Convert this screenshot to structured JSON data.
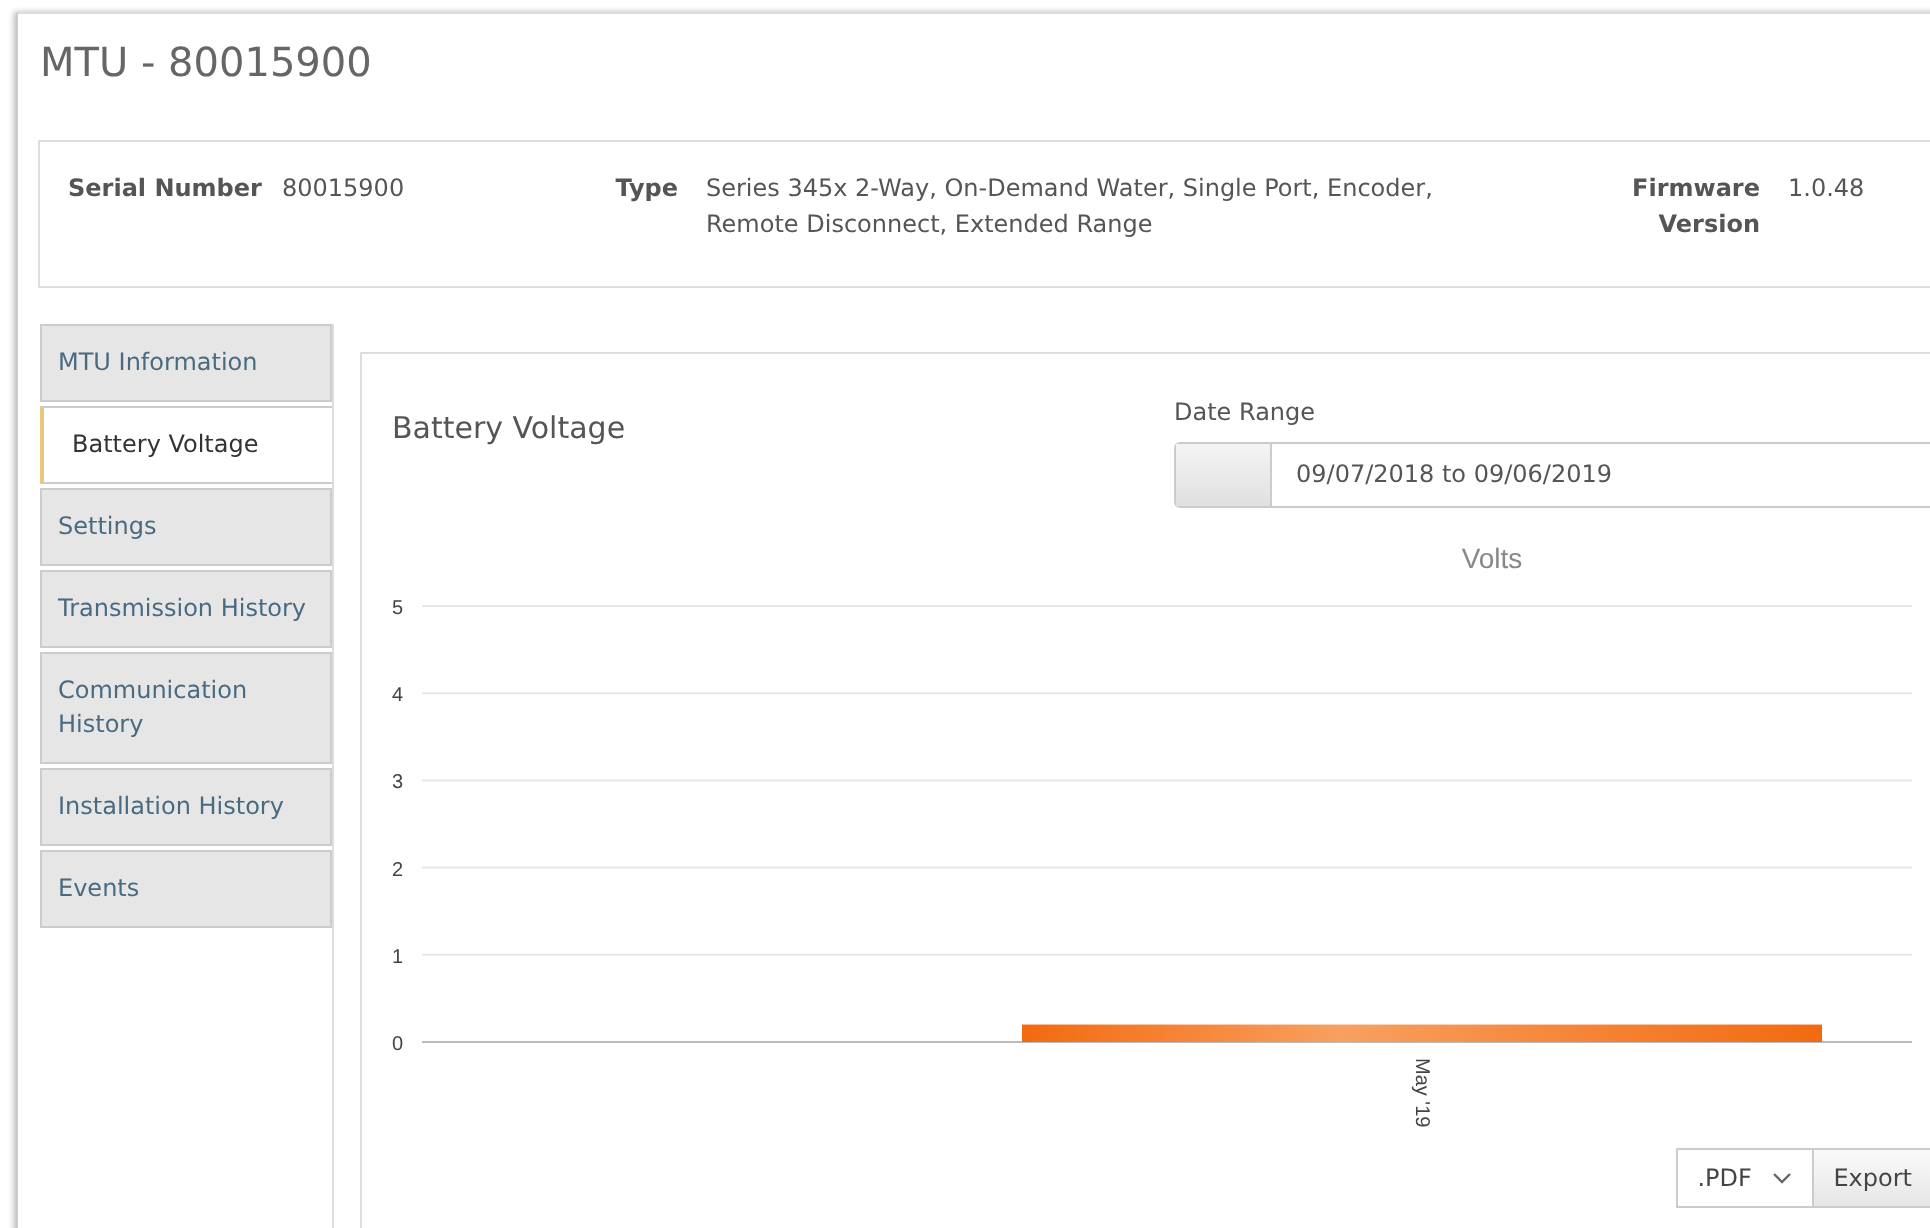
{
  "page_title": "MTU - 80015900",
  "info": [
    {
      "label": "Serial Number",
      "value": "80015900"
    },
    {
      "label": "Type",
      "value": "Series 345x 2-Way, On-Demand Water, Single Port, Encoder, Remote Disconnect, Extended Range"
    },
    {
      "label": "Firmware Version",
      "value": "1.0.48"
    }
  ],
  "tabs": [
    {
      "label": "MTU Information",
      "selected": false
    },
    {
      "label": "Battery Voltage",
      "selected": true
    },
    {
      "label": "Settings",
      "selected": false
    },
    {
      "label": "Transmission History",
      "selected": false
    },
    {
      "label": "Communication History",
      "selected": false
    },
    {
      "label": "Installation History",
      "selected": false
    },
    {
      "label": "Events",
      "selected": false
    }
  ],
  "panel": {
    "title": "Battery Voltage",
    "date_range": {
      "label": "Date Range",
      "value": "09/07/2018 to 09/06/2019"
    },
    "chart_data": {
      "type": "bar",
      "grid": true,
      "categories": [
        "May '19"
      ],
      "series": [
        {
          "name": "Volts",
          "color": "#f26a10",
          "values": [
            0.2
          ]
        }
      ],
      "ylim": [
        0,
        5
      ],
      "yticks": [
        0,
        1,
        2,
        3,
        4,
        5
      ]
    },
    "format": ".PDF",
    "export": "Export"
  }
}
